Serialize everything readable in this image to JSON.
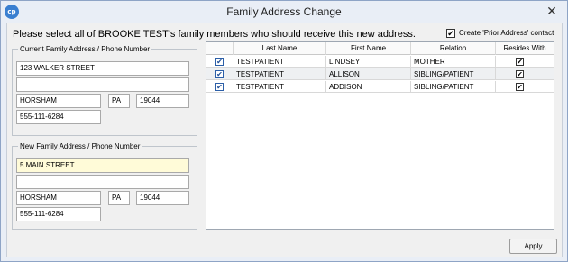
{
  "window": {
    "title": "Family Address Change",
    "close_glyph": "✕",
    "app_icon": "app-logo-icon",
    "app_icon_text": "cp"
  },
  "instruction": "Please select all of BROOKE TEST's family members who should receive this new address.",
  "prior_address": {
    "label": "Create 'Prior Address' contact",
    "checked": true,
    "check_glyph": "✔"
  },
  "current": {
    "legend": "Current Family Address  /  Phone Number",
    "address1": "123 WALKER STREET",
    "address2": "",
    "city": "HORSHAM",
    "state": "PA",
    "zip": "19044",
    "phone": "555-111-6284"
  },
  "new": {
    "legend": "New Family Address  /  Phone Number",
    "address1": "5 MAIN STREET",
    "address2": "",
    "city": "HORSHAM",
    "state": "PA",
    "zip": "19044",
    "phone": "555-111-6284"
  },
  "grid": {
    "columns": [
      "",
      "Last Name",
      "First Name",
      "Relation",
      "Resides With"
    ],
    "rows": [
      {
        "selected": "✔",
        "last": "TESTPATIENT",
        "first": "LINDSEY",
        "relation": "MOTHER",
        "resides": "✔"
      },
      {
        "selected": "✔",
        "last": "TESTPATIENT",
        "first": "ALLISON",
        "relation": "SIBLING/PATIENT",
        "resides": "✔"
      },
      {
        "selected": "✔",
        "last": "TESTPATIENT",
        "first": "ADDISON",
        "relation": "SIBLING/PATIENT",
        "resides": "✔"
      }
    ]
  },
  "apply_label": "Apply",
  "colors": {
    "highlight": "#fffbd8",
    "accent": "#2c5fa8"
  }
}
